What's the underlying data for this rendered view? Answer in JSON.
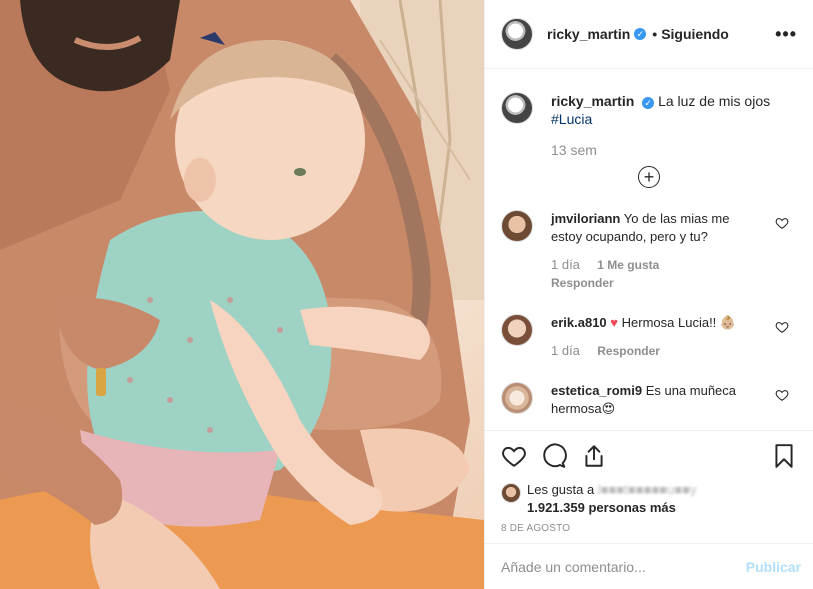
{
  "header": {
    "username": "ricky_martin",
    "separator": "•",
    "follow_status": "Siguiendo",
    "more": "•••"
  },
  "caption": {
    "username": "ricky_martin",
    "text": "La luz de mis ojos",
    "hashtag": "#Lucia",
    "time": "13 sem"
  },
  "load_more": "+",
  "comments": [
    {
      "username": "jmviloriann",
      "text": "Yo de las mias me estoy ocupando, pero y tu?",
      "time": "1 día",
      "likes": "1 Me gusta",
      "reply": "Responder"
    },
    {
      "username": "erik.a810",
      "emoji": "♥",
      "text": "Hermosa Lucia!! 👶🏼",
      "time": "1 día",
      "reply": "Responder"
    },
    {
      "username": "estetica_romi9",
      "text": "Es una muñeca hermosa😍"
    }
  ],
  "likes": {
    "prefix": "Les gusta a",
    "blurred_user": "l■■■t■■■■■u■■y",
    "count": "1.921.359 personas más"
  },
  "date": "8 DE AGOSTO",
  "add_comment": {
    "placeholder": "Añade un comentario...",
    "publish": "Publicar"
  },
  "colors": {
    "accent": "#3897f0",
    "heart_red": "#ed4956",
    "publish_disabled": "#b2dffc",
    "muted": "#8e8e8e"
  },
  "icons": [
    "heart-icon",
    "comment-icon",
    "share-icon",
    "bookmark-icon",
    "verified-badge-icon",
    "plus-circle-icon"
  ]
}
